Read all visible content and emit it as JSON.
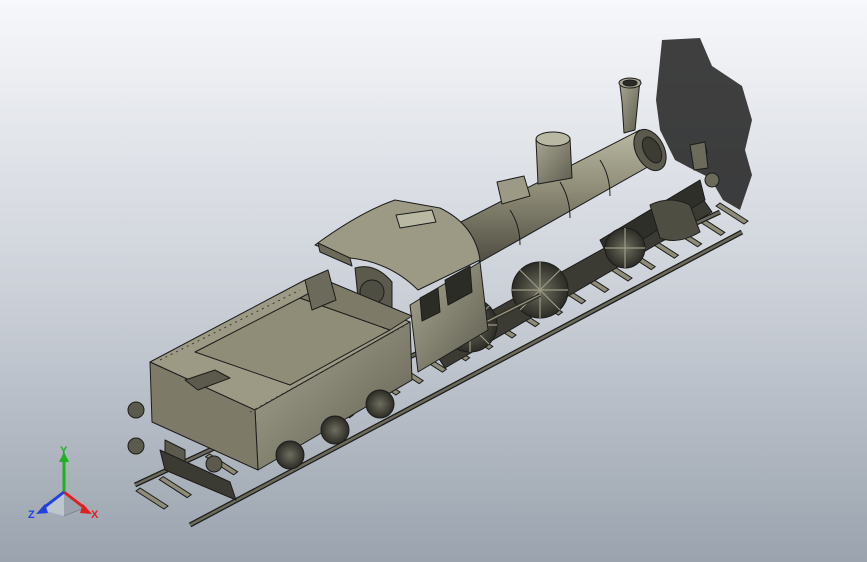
{
  "viewport": {
    "background_top": "#f7f8fb",
    "background_bottom": "#9aa3ae",
    "model_color": "#8f8d78",
    "model_shade": "#5b5a4c",
    "edge_color": "#1c1c1c",
    "shadow_color": "#202020"
  },
  "model": {
    "name": "steam-locomotive-with-tender"
  },
  "triad": {
    "x_label": "X",
    "y_label": "Y",
    "z_label": "Z",
    "x_color": "#e02020",
    "y_color": "#20b020",
    "z_color": "#2040e0"
  }
}
